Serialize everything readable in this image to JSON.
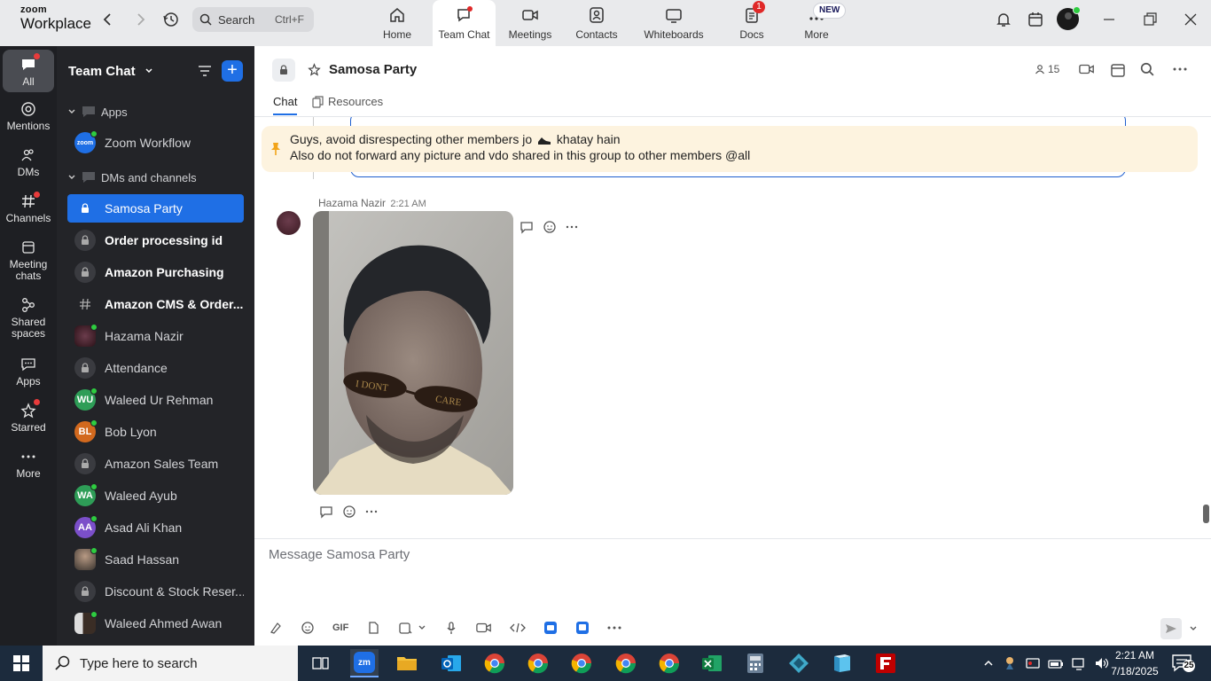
{
  "titlebar": {
    "logo_top": "zoom",
    "logo_bottom": "Workplace",
    "search_placeholder": "Search",
    "search_shortcut": "Ctrl+F",
    "tabs": [
      {
        "label": "Home",
        "icon": "home-icon"
      },
      {
        "label": "Team Chat",
        "icon": "chat-icon"
      },
      {
        "label": "Meetings",
        "icon": "video-icon"
      },
      {
        "label": "Contacts",
        "icon": "contacts-icon"
      },
      {
        "label": "Whiteboards",
        "icon": "whiteboard-icon"
      },
      {
        "label": "Docs",
        "icon": "docs-icon"
      },
      {
        "label": "More",
        "icon": "more-dots-icon"
      }
    ],
    "docs_badge": "1",
    "more_badge": "NEW"
  },
  "rail": {
    "items": [
      {
        "label": "All"
      },
      {
        "label": "Mentions"
      },
      {
        "label": "DMs"
      },
      {
        "label": "Channels"
      },
      {
        "label": "Meeting chats"
      },
      {
        "label": "Shared spaces"
      },
      {
        "label": "Apps"
      },
      {
        "label": "Starred"
      },
      {
        "label": "More"
      }
    ]
  },
  "sidebar": {
    "title": "Team Chat",
    "section_apps": "Apps",
    "section_dms": "DMs and channels",
    "apps": [
      {
        "label": "Zoom Workflow",
        "avatar_text": "zoom"
      }
    ],
    "items": [
      {
        "label": "Samosa Party",
        "type": "lock",
        "active": true,
        "bold": false
      },
      {
        "label": "Order processing id",
        "type": "lock",
        "bold": true
      },
      {
        "label": "Amazon Purchasing",
        "type": "lock",
        "bold": true
      },
      {
        "label": "Amazon CMS & Order...",
        "type": "hash",
        "bold": true
      },
      {
        "label": "Hazama Nazir",
        "type": "photo",
        "online": true
      },
      {
        "label": "Attendance",
        "type": "lock"
      },
      {
        "label": "Waleed Ur Rehman",
        "type": "initials",
        "initials": "WU",
        "color": "#2e9d57",
        "online": true
      },
      {
        "label": "Bob Lyon",
        "type": "initials",
        "initials": "BL",
        "color": "#d2691e",
        "online": true
      },
      {
        "label": "Amazon Sales Team",
        "type": "lock"
      },
      {
        "label": "Waleed Ayub",
        "type": "initials",
        "initials": "WA",
        "color": "#2e9d57",
        "online": true
      },
      {
        "label": "Asad Ali Khan",
        "type": "initials",
        "initials": "AA",
        "color": "#7b4fc9",
        "online": true
      },
      {
        "label": "Saad Hassan",
        "type": "photo",
        "online": true
      },
      {
        "label": "Discount & Stock Reser...",
        "type": "lock"
      },
      {
        "label": "Waleed Ahmed Awan",
        "type": "photo",
        "online": true
      }
    ]
  },
  "channel": {
    "title": "Samosa Party",
    "member_count": "15",
    "tab_chat": "Chat",
    "tab_resources": "Resources"
  },
  "pinned": {
    "line1_before": "Guys, avoid disrespecting other members jo",
    "line1_after": "khatay hain",
    "line2": "Also do not forward any picture and vdo shared in this group to other members @all"
  },
  "message": {
    "sender": "Hazama Nazir",
    "time": "2:21 AM",
    "glasses_left": "I DONT",
    "glasses_right": "CARE"
  },
  "composer": {
    "placeholder": "Message Samosa Party",
    "gif_label": "GIF"
  },
  "taskbar": {
    "search_placeholder": "Type here to search",
    "time": "2:21 AM",
    "date": "7/18/2025",
    "notification_count": "25",
    "zoom_label": "zm"
  },
  "colors": {
    "accent": "#1f6fe5",
    "sidebar_bg": "#232428",
    "rail_bg": "#1e1f23",
    "pinned_bg": "#fdf3df",
    "online": "#2ecc40",
    "badge": "#e02828"
  }
}
